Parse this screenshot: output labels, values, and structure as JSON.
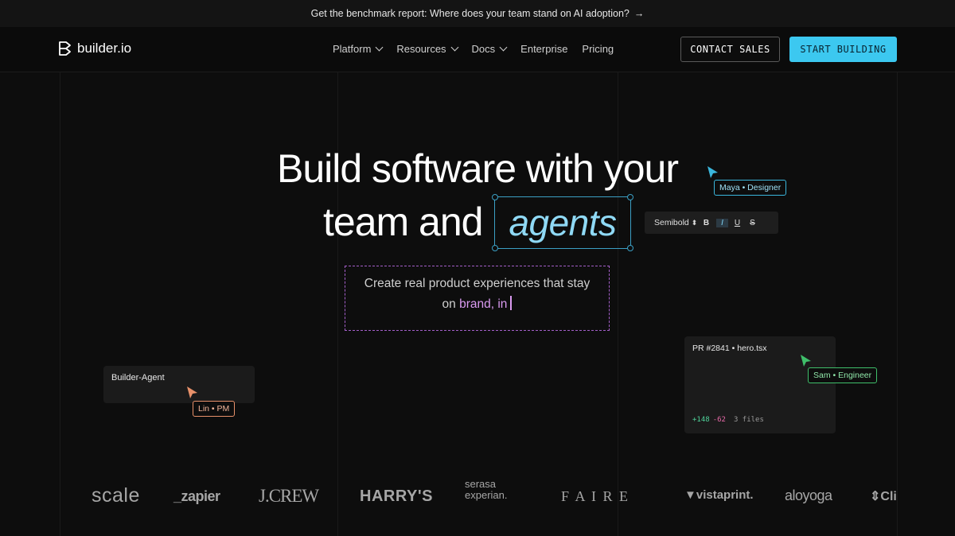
{
  "banner": {
    "text": "Get the benchmark report: Where does your team stand on AI adoption?",
    "arrow": "→"
  },
  "nav": {
    "logo_text": "builder.io",
    "menu": [
      {
        "label": "Platform",
        "dropdown": true
      },
      {
        "label": "Resources",
        "dropdown": true
      },
      {
        "label": "Docs",
        "dropdown": true
      },
      {
        "label": "Enterprise",
        "dropdown": false
      },
      {
        "label": "Pricing",
        "dropdown": false
      }
    ],
    "contact_label": "CONTACT SALES",
    "start_label": "START BUILDING"
  },
  "hero": {
    "line1": "Build software with your",
    "line2_prefix": "team and",
    "highlight": "agents",
    "subtitle_line1": "Create real product experiences that stay",
    "subtitle_line2_plain": "on",
    "subtitle_line2_pink": "brand, in"
  },
  "toolbar": {
    "font": "Semibold",
    "font_arrows": "⬍",
    "bold": "B",
    "italic": "I",
    "underline": "U",
    "strike": "S"
  },
  "collaborators": {
    "maya": "Maya • Designer",
    "lin": "Lin • PM",
    "sam": "Sam • Engineer"
  },
  "agent_card": {
    "title": "Builder-Agent"
  },
  "pr_card": {
    "title": "PR #2841 • hero.tsx",
    "additions": "+148",
    "deletions": "-62",
    "files": "3 files"
  },
  "brands": [
    "scale",
    "_zapier",
    "J.CREW",
    "HARRY'S",
    "serasa experian.",
    "F A I R E",
    "vistaprint.",
    "aloyoga",
    "Cli"
  ],
  "colors": {
    "accent": "#3cc8f0",
    "pink": "#d99af0",
    "orange": "#e8916a",
    "green": "#3fbf6a"
  }
}
